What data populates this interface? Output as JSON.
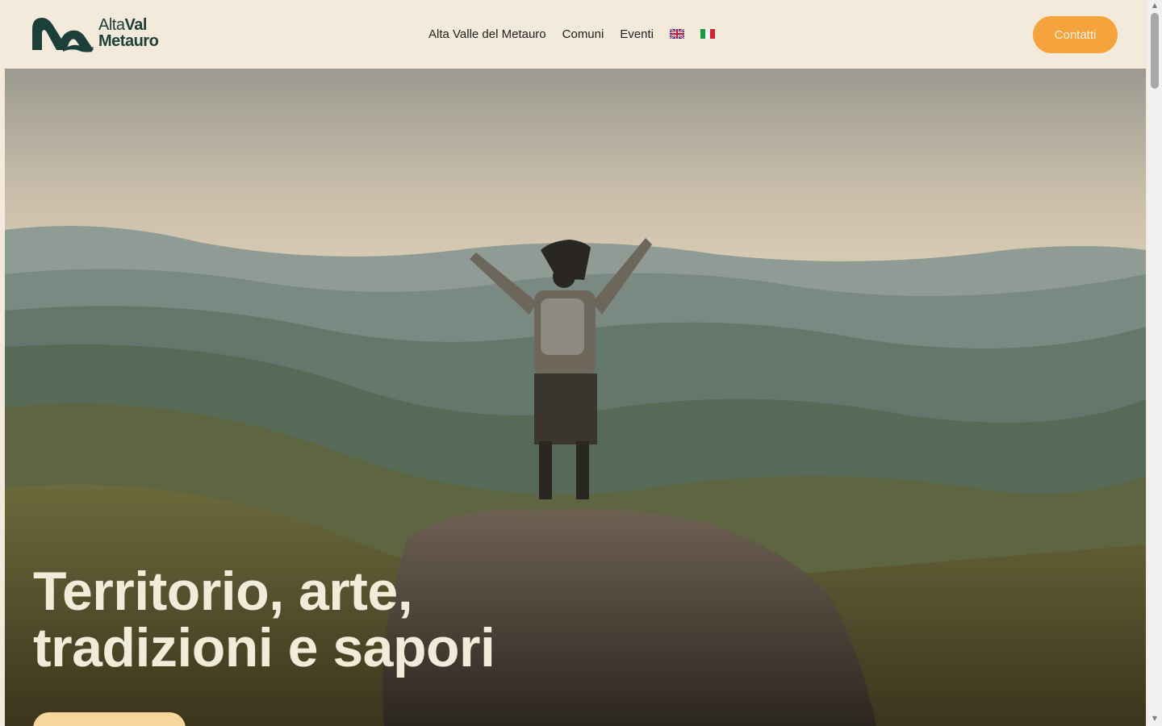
{
  "brand": {
    "line1_light": "Alta",
    "line1_bold": "Val",
    "line2": "Metauro",
    "colors": {
      "primary": "#1d3f39",
      "accent": "#f5a33c",
      "background": "#f3eadb",
      "hero_text": "#f4ead9"
    }
  },
  "nav": {
    "items": [
      {
        "label": "Alta Valle del Metauro"
      },
      {
        "label": "Comuni"
      },
      {
        "label": "Eventi"
      }
    ],
    "languages": [
      {
        "icon": "uk-flag-icon"
      },
      {
        "icon": "italy-flag-icon"
      }
    ],
    "cta_label": "Contatti"
  },
  "hero": {
    "title_line1": "Territorio, arte,",
    "title_line2": "tradizioni e sapori",
    "image": "hiker-on-mountain-rock-photo"
  }
}
